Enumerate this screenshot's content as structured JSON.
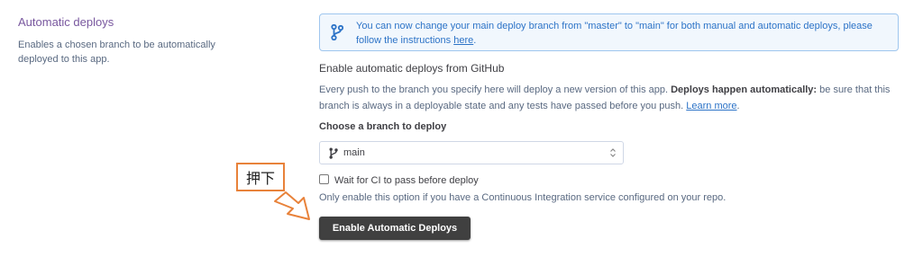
{
  "left": {
    "title": "Automatic deploys",
    "description": "Enables a chosen branch to be automatically deployed to this app."
  },
  "notice": {
    "text": "You can now change your main deploy branch from \"master\" to \"main\" for both manual and automatic deploys, please follow the instructions ",
    "link": "here",
    "suffix": ".",
    "icon": "git-branch-icon"
  },
  "main": {
    "heading": "Enable automatic deploys from GitHub",
    "description": "Every push to the branch you specify here will deploy a new version of this app. ",
    "description_bold": "Deploys happen automatically:",
    "description_rest": " be sure that this branch is always in a deployable state and any tests have passed before you push. ",
    "learn_more": "Learn more",
    "period": ".",
    "choose_label": "Choose a branch to deploy",
    "branch_value": "main",
    "ci_checkbox_label": "Wait for CI to pass before deploy",
    "ci_checked": false,
    "ci_help": "Only enable this option if you have a Continuous Integration service configured on your repo.",
    "button_label": "Enable Automatic Deploys"
  },
  "annotation": {
    "label": "押下",
    "color": "#e8823a"
  },
  "colors": {
    "accent_purple": "#79589f",
    "link_blue": "#2c73c7",
    "notice_border": "#9fc6ee",
    "button_bg": "#404040"
  }
}
